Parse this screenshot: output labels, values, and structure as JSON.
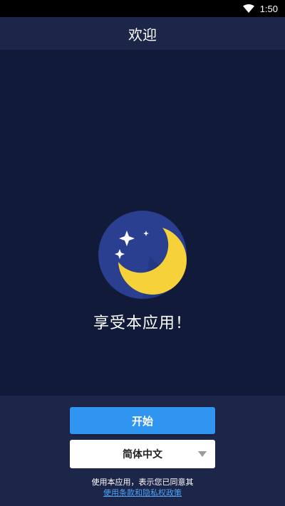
{
  "status_bar": {
    "time": "1:50",
    "wifi_icon": "wifi-icon"
  },
  "header": {
    "title": "欢迎"
  },
  "main": {
    "logo_icon": "moon-stars-icon",
    "tagline": "享受本应用！"
  },
  "footer": {
    "start_button_label": "开始",
    "language_selected": "简体中文",
    "terms_text": "使用本应用，表示您已同意其",
    "terms_link": "使用条款和隐私权政策"
  },
  "colors": {
    "background": "#121a3a",
    "panel": "#1c2649",
    "primary": "#2f95f0",
    "moon_circle": "#2a3f8f",
    "moon": "#f7d13a",
    "link": "#4fa3f7"
  }
}
